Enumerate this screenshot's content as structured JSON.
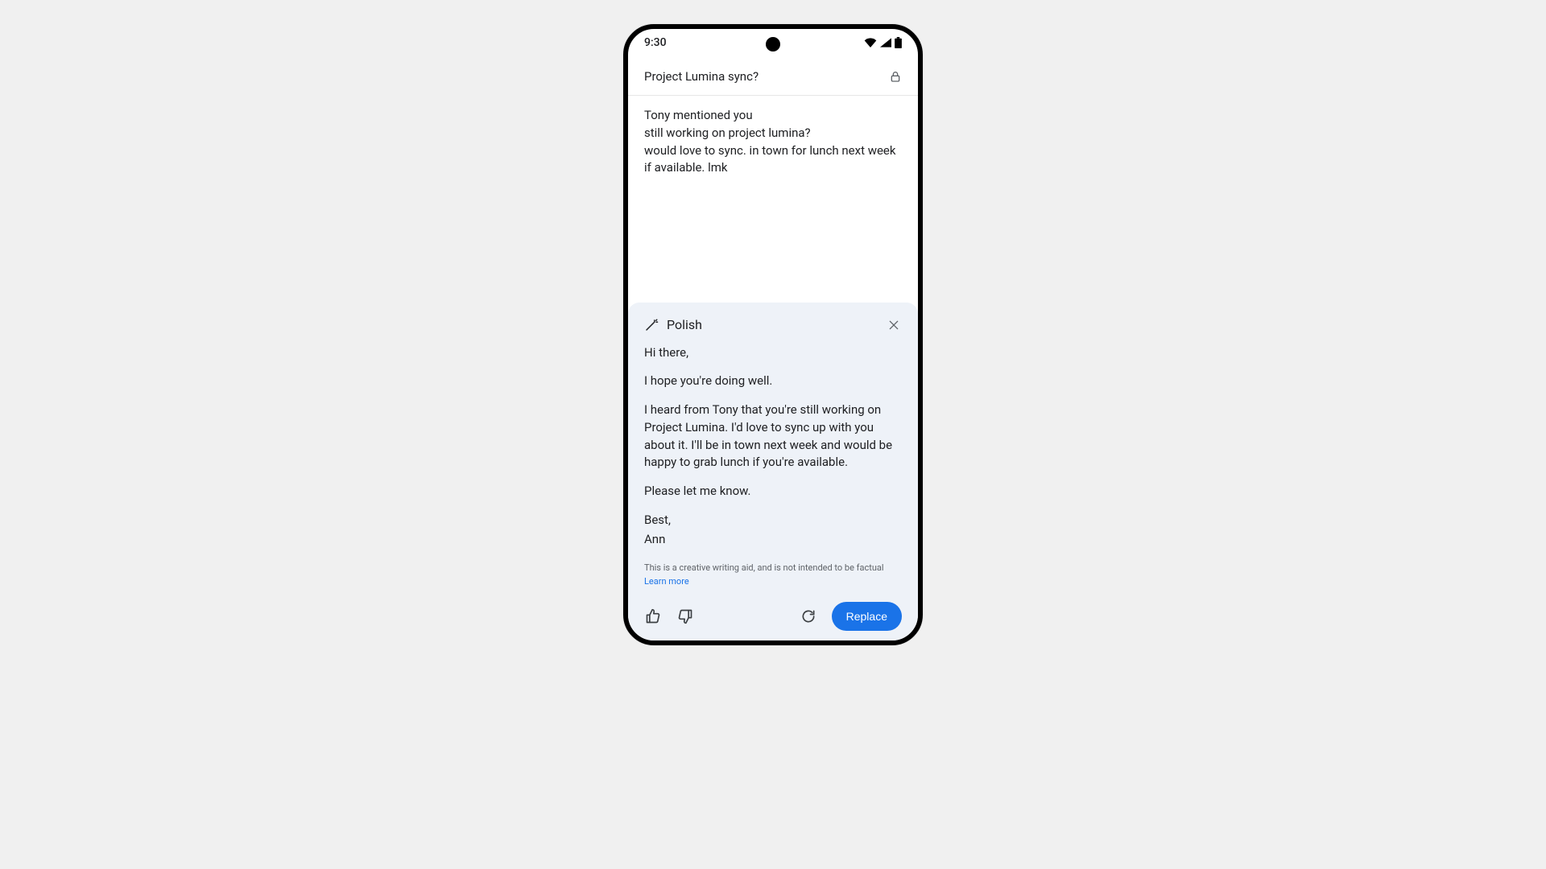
{
  "statusbar": {
    "time": "9:30"
  },
  "compose": {
    "subject": "Project Lumina sync?",
    "draft_line1": "Tony mentioned you",
    "draft_line2": "still working on project lumina?",
    "draft_line3": "would love to sync. in town for lunch next week if available. lmk"
  },
  "polish": {
    "title": "Polish",
    "greeting": "Hi there,",
    "line_hope": "I hope you're doing well.",
    "body_main": "I heard from Tony that you're still working on Project Lumina. I'd love to sync up with you about it. I'll be in town next week and would be happy to grab lunch if you're available.",
    "line_please": "Please let me know.",
    "signoff": "Best,",
    "signature": "Ann",
    "disclaimer": "This is a creative writing aid, and is not intended to be factual",
    "learn_more": "Learn more",
    "replace_label": "Replace"
  },
  "colors": {
    "accent": "#1a73e8",
    "panel_bg": "#eef2f8",
    "page_bg": "#f0f0f0"
  }
}
